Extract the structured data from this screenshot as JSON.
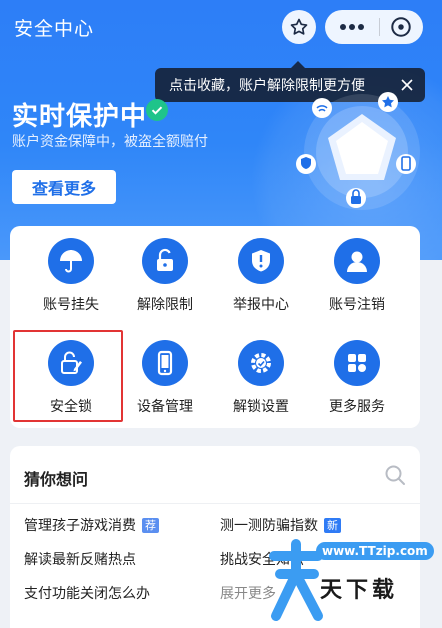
{
  "header": {
    "title": "安全中心",
    "icons": {
      "favorite": "star-icon",
      "more": "more-icon",
      "close": "close-circle-icon"
    }
  },
  "tip": {
    "text": "点击收藏，账户解除限制更方便"
  },
  "hero": {
    "title": "实时保护中",
    "subtitle": "账户资金保障中，被盗全额赔付",
    "view_more": "查看更多",
    "check_color": "#1fc48a"
  },
  "services": [
    {
      "label": "账号挂失",
      "icon": "umbrella-icon"
    },
    {
      "label": "解除限制",
      "icon": "unlock-icon"
    },
    {
      "label": "举报中心",
      "icon": "alert-shield-icon"
    },
    {
      "label": "账号注销",
      "icon": "user-icon"
    },
    {
      "label": "安全锁",
      "icon": "security-lock-icon"
    },
    {
      "label": "设备管理",
      "icon": "phone-icon"
    },
    {
      "label": "解锁设置",
      "icon": "gear-icon"
    },
    {
      "label": "更多服务",
      "icon": "grid-icon"
    }
  ],
  "guess": {
    "title": "猜你想问",
    "questions": [
      {
        "text": "管理孩子游戏消费",
        "badge": "荐",
        "badge_color": "#5b8ff0"
      },
      {
        "text": "测一测防骗指数",
        "badge": "新",
        "badge_color": "#2f7bf5"
      },
      {
        "text": "解读最新反赌热点"
      },
      {
        "text": "挑战安全知识"
      },
      {
        "text": "支付功能关闭怎么办"
      },
      {
        "text": "展开更多"
      }
    ]
  },
  "watermark": {
    "url": "www.TTzip.com",
    "text": "天下载"
  },
  "colors": {
    "primary": "#1f6fe8",
    "hero_bg": "#2d7ef7",
    "highlight": "#e23434"
  }
}
